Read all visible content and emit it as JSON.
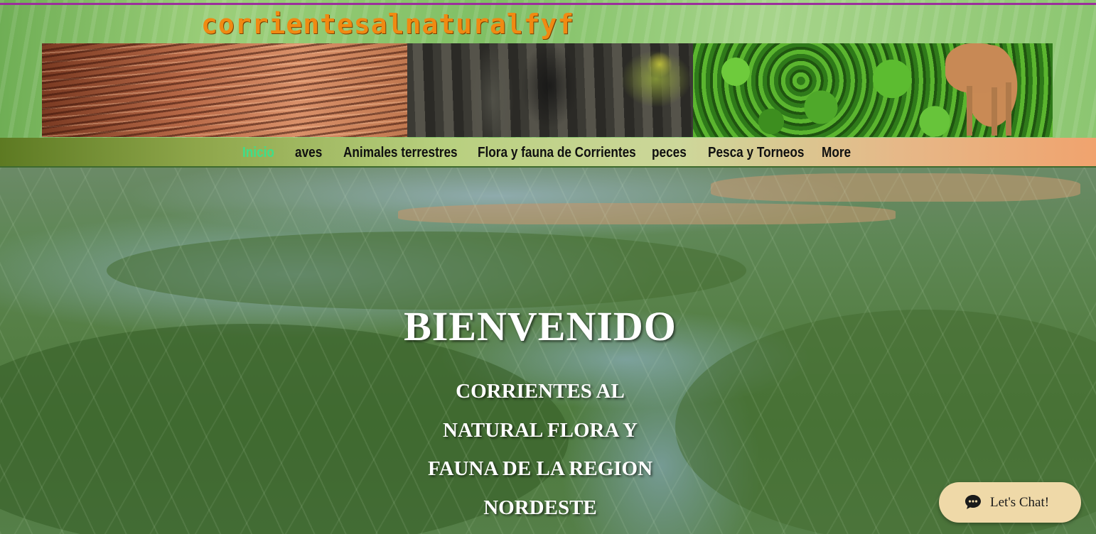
{
  "site": {
    "title": "corrientesalnaturalfyf"
  },
  "nav": {
    "items": [
      {
        "label": "Inicio",
        "active": true
      },
      {
        "label": "aves",
        "active": false
      },
      {
        "label": "Animales terrestres",
        "active": false
      },
      {
        "label": "Flora y fauna de Corrientes",
        "active": false
      },
      {
        "label": "peces",
        "active": false
      },
      {
        "label": "Pesca y Torneos",
        "active": false
      },
      {
        "label": "More",
        "active": false
      }
    ],
    "active_color": "#3de08a"
  },
  "hero": {
    "heading": "BIENVENIDO",
    "subheading_lines": [
      "CORRIENTES AL",
      "NATURAL FLORA Y",
      "FAUNA DE LA REGION",
      "NORDESTE"
    ]
  },
  "chat": {
    "label": "Let's Chat!",
    "icon": "chat-bubble-icon",
    "background": "#efd9a8"
  },
  "colors": {
    "title": "#f08a12",
    "top_line": "#9b2f9b"
  }
}
